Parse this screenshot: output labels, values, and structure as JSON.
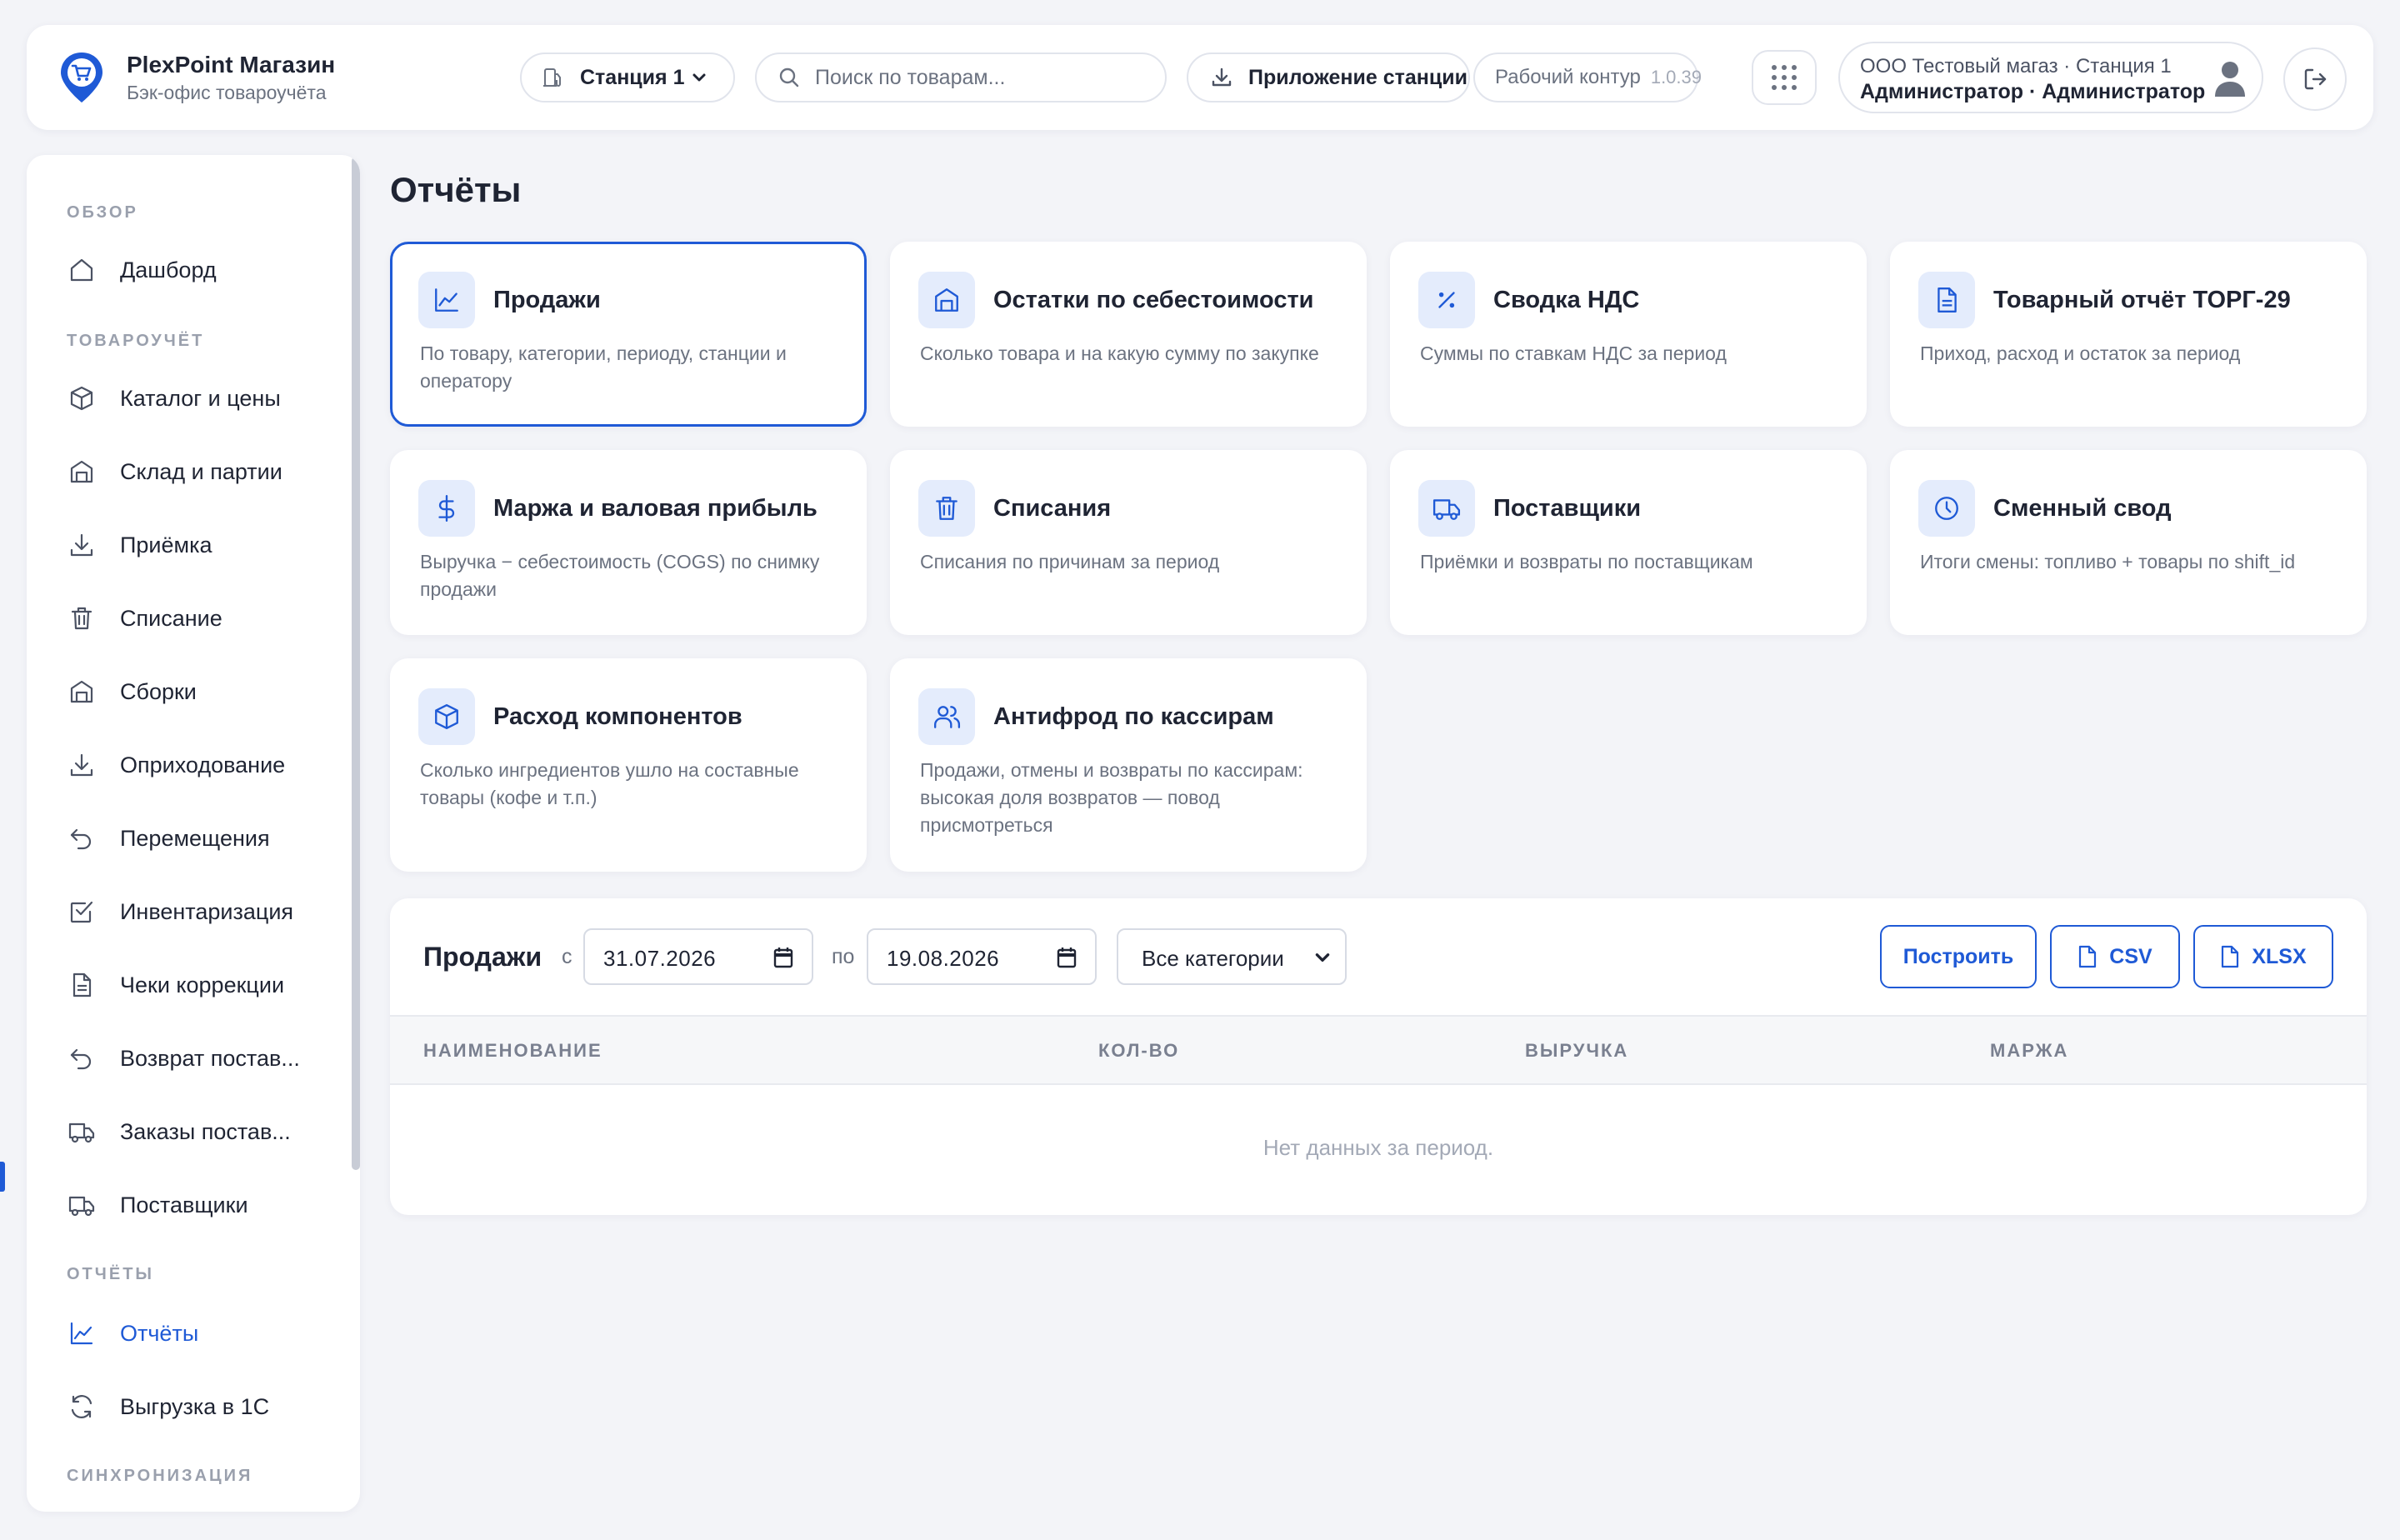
{
  "brand": {
    "title": "PlexPoint Магазин",
    "subtitle": "Бэк-офис товароучёта"
  },
  "topbar": {
    "station": "Станция 1",
    "search_placeholder": "Поиск по товарам...",
    "app_button": "Приложение станции",
    "env_label": "Рабочий контур",
    "version": "1.0.39",
    "user_org": "ООО Тестовый магаз · Станция 1",
    "user_role": "Администратор · Администратор"
  },
  "sidebar": {
    "sections": [
      {
        "label": "ОБЗОР"
      },
      {
        "label": "ТОВАРОУЧЁТ"
      },
      {
        "label": "ОТЧЁТЫ"
      },
      {
        "label": "СИНХРОНИЗАЦИЯ"
      }
    ],
    "items": [
      {
        "label": "Дашборд",
        "icon": "home-icon"
      },
      {
        "label": "Каталог и цены",
        "icon": "box-icon"
      },
      {
        "label": "Склад и партии",
        "icon": "warehouse-icon"
      },
      {
        "label": "Приёмка",
        "icon": "download-icon"
      },
      {
        "label": "Списание",
        "icon": "trash-icon"
      },
      {
        "label": "Сборки",
        "icon": "warehouse-icon"
      },
      {
        "label": "Оприходование",
        "icon": "download-icon"
      },
      {
        "label": "Перемещения",
        "icon": "return-arrow-icon"
      },
      {
        "label": "Инвентаризация",
        "icon": "checkbox-icon"
      },
      {
        "label": "Чеки коррекции",
        "icon": "document-icon"
      },
      {
        "label": "Возврат постав...",
        "icon": "return-arrow-icon"
      },
      {
        "label": "Заказы постав...",
        "icon": "truck-icon"
      },
      {
        "label": "Поставщики",
        "icon": "truck-icon"
      },
      {
        "label": "Отчёты",
        "icon": "chart-icon",
        "active": true
      },
      {
        "label": "Выгрузка в 1С",
        "icon": "sync-icon"
      }
    ]
  },
  "page": {
    "title": "Отчёты"
  },
  "cards": [
    {
      "title": "Продажи",
      "desc": "По товару, категории, периоду, станции и оператору",
      "icon": "chart-icon",
      "selected": true
    },
    {
      "title": "Остатки по себестоимости",
      "desc": "Сколько товара и на какую сумму по закупке",
      "icon": "warehouse-icon"
    },
    {
      "title": "Сводка НДС",
      "desc": "Суммы по ставкам НДС за период",
      "icon": "percent-icon"
    },
    {
      "title": "Товарный отчёт ТОРГ-29",
      "desc": "Приход, расход и остаток за период",
      "icon": "document-icon"
    },
    {
      "title": "Маржа и валовая прибыль",
      "desc": "Выручка − себестоимость (COGS) по снимку продажи",
      "icon": "dollar-icon"
    },
    {
      "title": "Списания",
      "desc": "Списания по причинам за период",
      "icon": "trash-icon"
    },
    {
      "title": "Поставщики",
      "desc": "Приёмки и возвраты по поставщикам",
      "icon": "truck-icon"
    },
    {
      "title": "Сменный свод",
      "desc": "Итоги смены: топливо + товары по shift_id",
      "icon": "clock-icon"
    },
    {
      "title": "Расход компонентов",
      "desc": "Сколько ингредиентов ушло на составные товары (кофе и т.п.)",
      "icon": "box-icon"
    },
    {
      "title": "Антифрод по кассирам",
      "desc": "Продажи, отмены и возвраты по кассирам: высокая доля возвратов — повод присмотреться",
      "icon": "users-icon"
    }
  ],
  "report": {
    "title": "Продажи",
    "from_label": "с",
    "date_from": "31.07.2026",
    "to_label": "по",
    "date_to": "19.08.2026",
    "category": "Все категории",
    "build_button": "Построить",
    "csv_button": "CSV",
    "xlsx_button": "XLSX",
    "columns": [
      "НАИМЕНОВАНИЕ",
      "КОЛ-ВО",
      "ВЫРУЧКА",
      "МАРЖА"
    ],
    "empty_text": "Нет данных за период."
  },
  "colors": {
    "accent": "#1f5ad6",
    "icon_bg": "#e4ecfc",
    "background": "#f3f4f8"
  }
}
